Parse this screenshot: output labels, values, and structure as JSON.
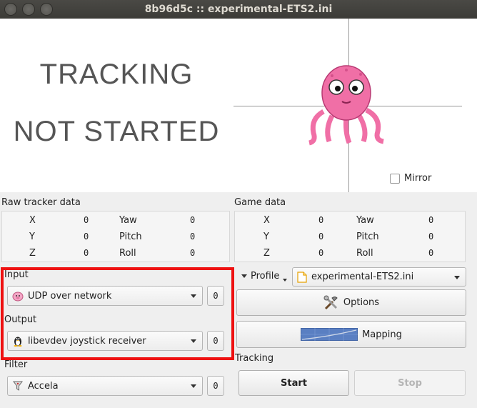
{
  "window": {
    "title": "8b96d5c :: experimental-ETS2.ini"
  },
  "status": {
    "line1": "TRACKING",
    "line2": "NOT STARTED"
  },
  "mirror": {
    "label": "Mirror",
    "checked": false
  },
  "raw_tracker": {
    "title": "Raw tracker data",
    "rows": [
      {
        "axis": "X",
        "axis_value": "0",
        "rot": "Yaw",
        "rot_value": "0"
      },
      {
        "axis": "Y",
        "axis_value": "0",
        "rot": "Pitch",
        "rot_value": "0"
      },
      {
        "axis": "Z",
        "axis_value": "0",
        "rot": "Roll",
        "rot_value": "0"
      }
    ]
  },
  "game_data": {
    "title": "Game data",
    "rows": [
      {
        "axis": "X",
        "axis_value": "0",
        "rot": "Yaw",
        "rot_value": "0"
      },
      {
        "axis": "Y",
        "axis_value": "0",
        "rot": "Pitch",
        "rot_value": "0"
      },
      {
        "axis": "Z",
        "axis_value": "0",
        "rot": "Roll",
        "rot_value": "0"
      }
    ]
  },
  "input": {
    "label": "Input",
    "selected": "UDP over network",
    "icon": "udp-pig-icon",
    "settings": "0"
  },
  "output": {
    "label": "Output",
    "selected": "libevdev joystick receiver",
    "icon": "tux-icon",
    "settings": "0"
  },
  "filter": {
    "label": "Filter",
    "selected": "Accela",
    "icon": "funnel-icon",
    "settings": "0"
  },
  "profile": {
    "label": "Profile",
    "selected": "experimental-ETS2.ini",
    "icon": "document-icon"
  },
  "buttons": {
    "options": "Options",
    "mapping": "Mapping"
  },
  "tracking": {
    "label": "Tracking",
    "start": "Start",
    "stop": "Stop"
  },
  "colors": {
    "highlight": "#ee1111",
    "titlebar": "#3c3b37",
    "octopus": "#f06fa6"
  }
}
